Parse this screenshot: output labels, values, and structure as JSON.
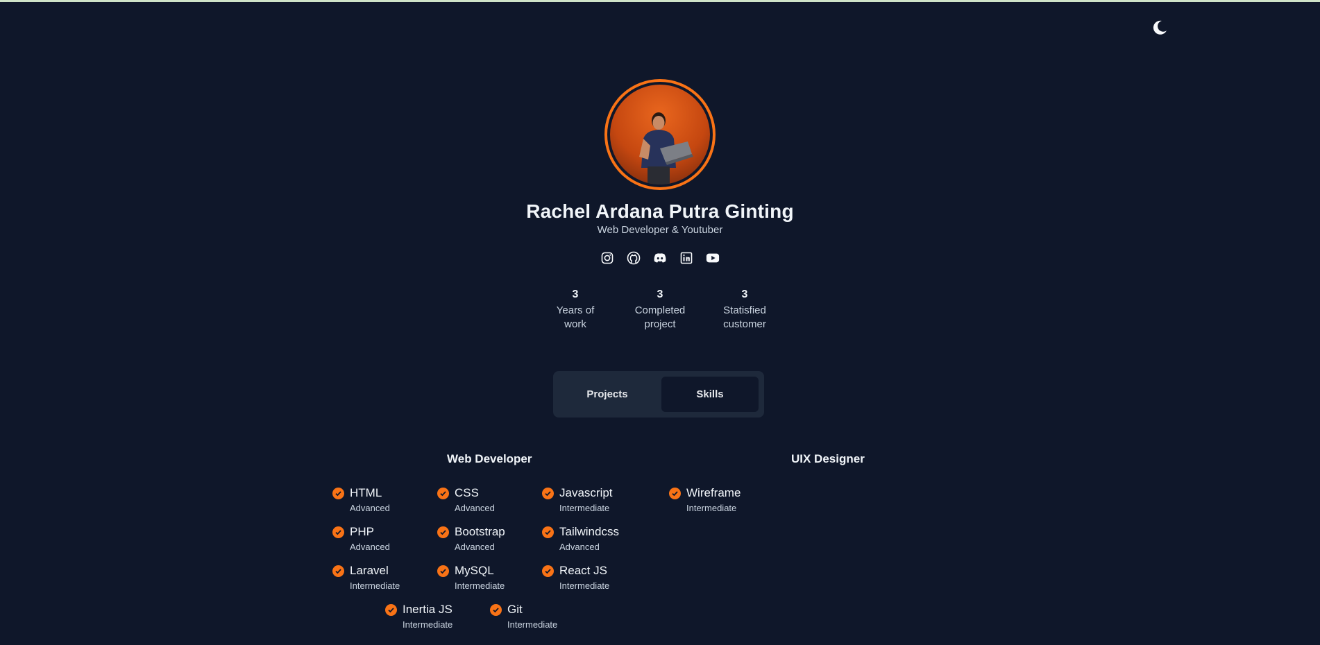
{
  "profile": {
    "name": "Rachel Ardana Putra Ginting",
    "subtitle": "Web Developer & Youtuber",
    "socials": [
      "instagram-icon",
      "github-icon",
      "discord-icon",
      "linkedin-icon",
      "youtube-icon"
    ]
  },
  "stats": [
    {
      "number": "3",
      "label": "Years of work"
    },
    {
      "number": "3",
      "label": "Completed project"
    },
    {
      "number": "3",
      "label": "Statisfied customer"
    }
  ],
  "tabs": [
    {
      "label": "Projects",
      "active": false
    },
    {
      "label": "Skills",
      "active": true
    }
  ],
  "skills": {
    "web_title": "Web Developer",
    "uix_title": "UIX Designer",
    "web": [
      {
        "name": "HTML",
        "level": "Advanced"
      },
      {
        "name": "CSS",
        "level": "Advanced"
      },
      {
        "name": "Javascript",
        "level": "Intermediate"
      },
      {
        "name": "PHP",
        "level": "Advanced"
      },
      {
        "name": "Bootstrap",
        "level": "Advanced"
      },
      {
        "name": "Tailwindcss",
        "level": "Advanced"
      },
      {
        "name": "Laravel",
        "level": "Intermediate"
      },
      {
        "name": "MySQL",
        "level": "Intermediate"
      },
      {
        "name": "React JS",
        "level": "Intermediate"
      },
      {
        "name": "Inertia JS",
        "level": "Intermediate"
      },
      {
        "name": "Git",
        "level": "Intermediate"
      }
    ],
    "uix": [
      {
        "name": "Wireframe",
        "level": "Intermediate"
      }
    ]
  },
  "colors": {
    "background": "#0f172a",
    "accent": "#f97316",
    "panel": "#1e293b"
  }
}
